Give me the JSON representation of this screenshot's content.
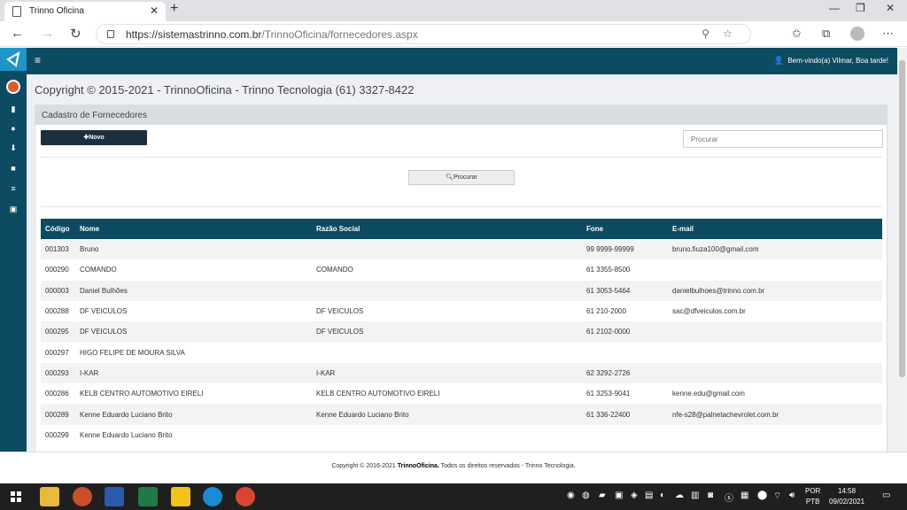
{
  "browser": {
    "tab_title": "Trinno Oficina",
    "url_host": "https://sistemastrinno.com.br",
    "url_path": "/TrinnoOficina/fornecedores.aspx"
  },
  "topnav": {
    "welcome": "Bem-vindo(a) Vilmar, Boa tarde!"
  },
  "header": {
    "copyright": "Copyright © 2015-2021 - TrinnoOficina - Trinno Tecnologia (61) 3327-8422"
  },
  "panel": {
    "title": "Cadastro de Fornecedores",
    "new_button": "Novo",
    "search_placeholder": "Procurar",
    "search_button": "Procurar"
  },
  "table": {
    "columns": [
      "Código",
      "Nome",
      "Razão Social",
      "Fone",
      "E-mail"
    ],
    "rows": [
      [
        "001303",
        "Bruno",
        "",
        "99 9999-99999",
        "bruno.fiuza100@gmail.com"
      ],
      [
        "000290",
        "COMANDO",
        "COMANDO",
        "61 3355-8500",
        ""
      ],
      [
        "000003",
        "Daniel Bulhões",
        "",
        "61 3053-5464",
        "danielbulhoes@trinno.com.br"
      ],
      [
        "000288",
        "DF VEICULOS",
        "DF VEICULOS",
        "61 210-2000",
        "sac@dfveiculos.com.br"
      ],
      [
        "000295",
        "DF VEICULOS",
        "DF VEICULOS",
        "61 2102-0000",
        ""
      ],
      [
        "000297",
        "HIGO FELIPE DE MOURA SILVA",
        "",
        "",
        ""
      ],
      [
        "000293",
        "I-KAR",
        "I-KAR",
        "62 3292-2726",
        ""
      ],
      [
        "000286",
        "KELB CENTRO AUTOMOTIVO EIRELI",
        "KELB CENTRO AUTOMOTIVO EIRELI",
        "61 3253-9041",
        "kenne.edu@gmail.com"
      ],
      [
        "000289",
        "Kenne Eduardo Luciano Brito",
        "Kenne Eduardo Luciano Brito",
        "61 336-22400",
        "nfe-s28@palnetachevrolet.com.br"
      ],
      [
        "000299",
        "Kenne Eduardo Luciano Brito",
        "",
        "",
        ""
      ]
    ]
  },
  "footer": {
    "prefix": "Copyright © 2016-2021 ",
    "brand": "TrinnoOficina.",
    "suffix": " Todos os direitos reservados - Trinno Tecnologia."
  },
  "taskbar": {
    "lang_line1": "POR",
    "lang_line2": "PTB",
    "time": "14:58",
    "date": "09/02/2021"
  },
  "colors": {
    "nav_dark": "#0d4b62",
    "logo_blue": "#1f95c9",
    "button_dark": "#1b2f3e"
  }
}
